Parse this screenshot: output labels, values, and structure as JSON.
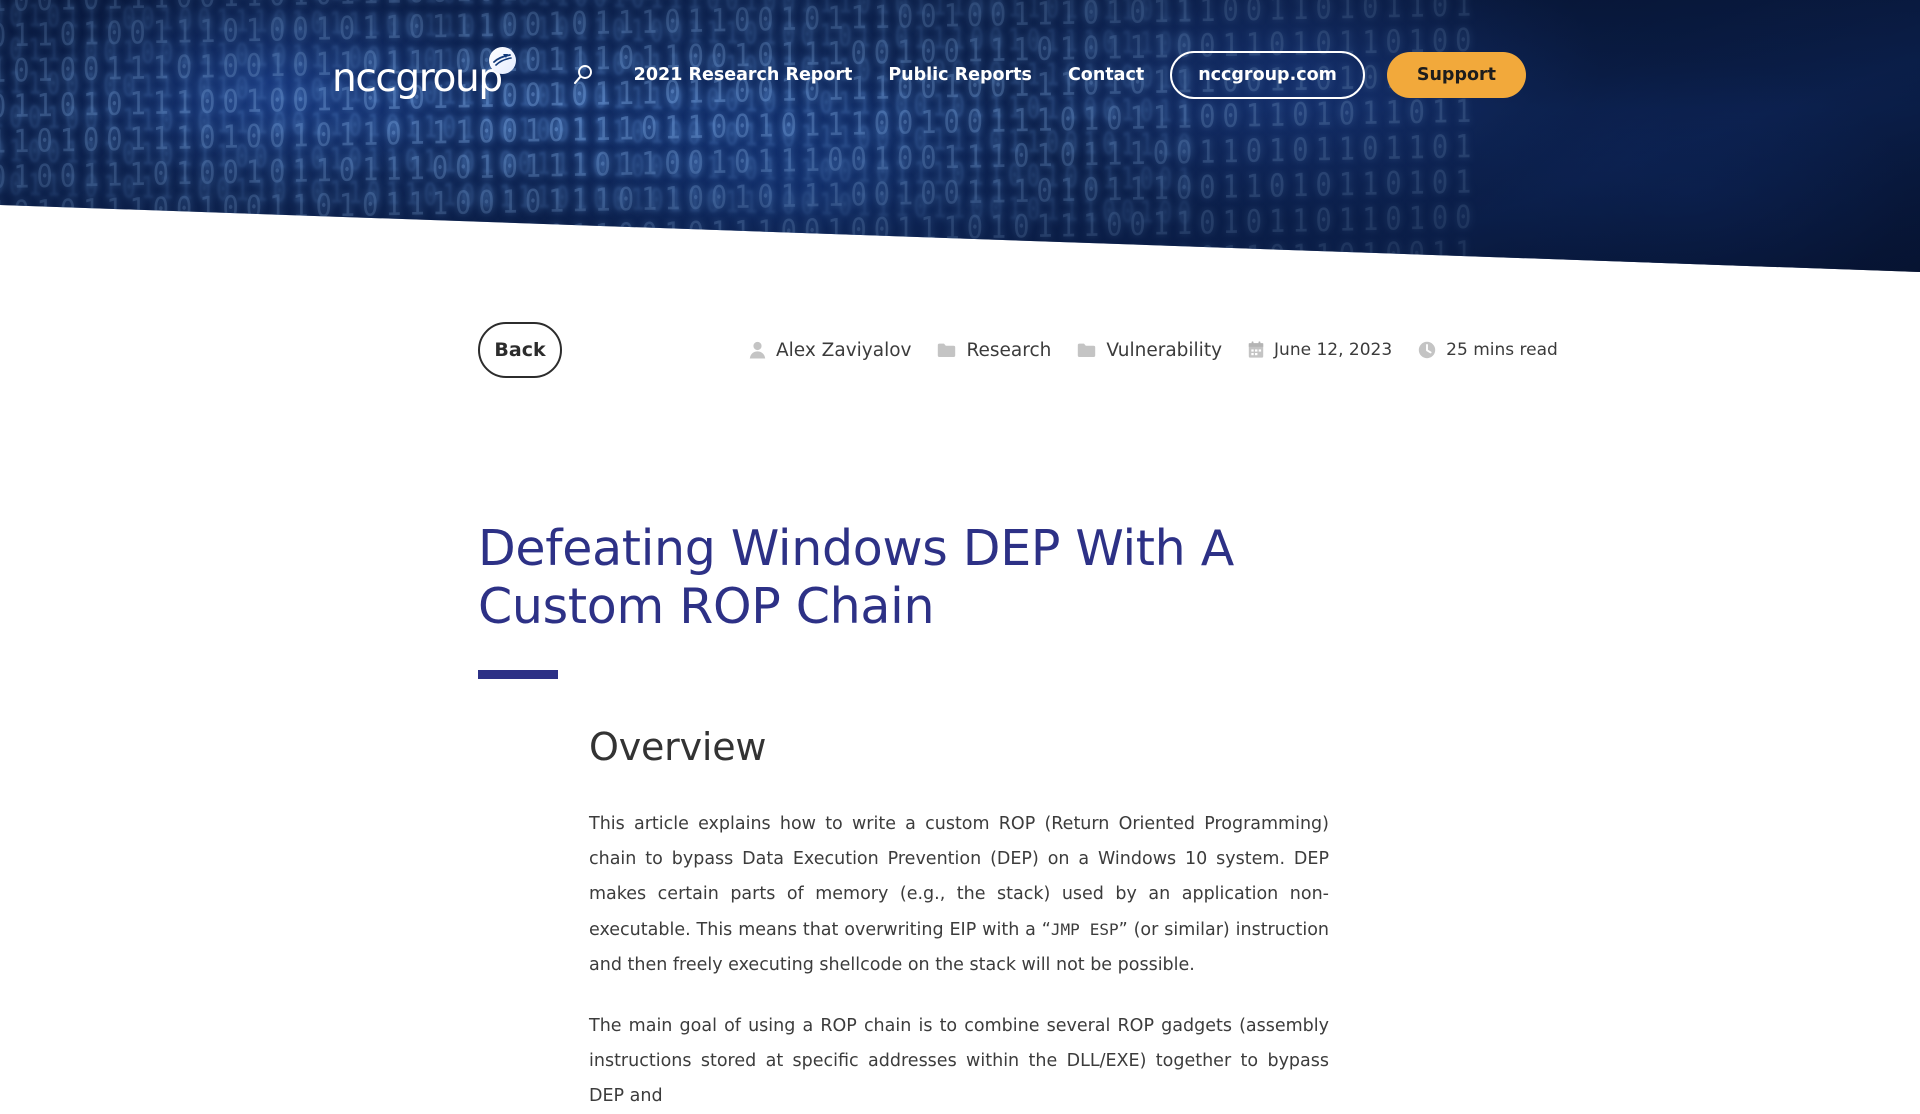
{
  "site": {
    "logo_text": "nccgroup",
    "logo_mark_icon": "swoosh-circle-icon"
  },
  "nav": {
    "search_icon": "search-icon",
    "links": [
      {
        "label": "2021 Research Report"
      },
      {
        "label": "Public Reports"
      },
      {
        "label": "Contact"
      }
    ],
    "pill_label": "nccgroup.com",
    "support_label": "Support",
    "support_color": "#f2a93b"
  },
  "toolbar": {
    "back_label": "Back"
  },
  "meta": [
    {
      "icon": "person-icon",
      "text": "Alex Zaviyalov"
    },
    {
      "icon": "folder-icon",
      "text": "Research"
    },
    {
      "icon": "folder-icon",
      "text": "Vulnerability"
    },
    {
      "icon": "calendar-icon",
      "text": "June 12, 2023"
    },
    {
      "icon": "clock-icon",
      "text": "25 mins read"
    }
  ],
  "article": {
    "title": "Defeating Windows DEP With A Custom ROP Chain",
    "title_color": "#2d3186",
    "section_heading": "Overview",
    "paragraph_1_a": "This article explains how to write a custom ROP (Return Oriented Programming) chain to bypass Data Execution Prevention (DEP) on a Windows 10 system. DEP makes certain parts of memory (e.g., the stack) used by an application non-executable. This means that overwriting EIP with a “",
    "paragraph_1_code": "JMP ESP",
    "paragraph_1_b": "” (or similar) instruction and then freely executing shellcode on the stack will not be possible.",
    "paragraph_2": "The main goal of using a ROP chain is to combine several ROP gadgets (assembly instructions stored at specific addresses within the DLL/EXE) together to bypass DEP and"
  }
}
